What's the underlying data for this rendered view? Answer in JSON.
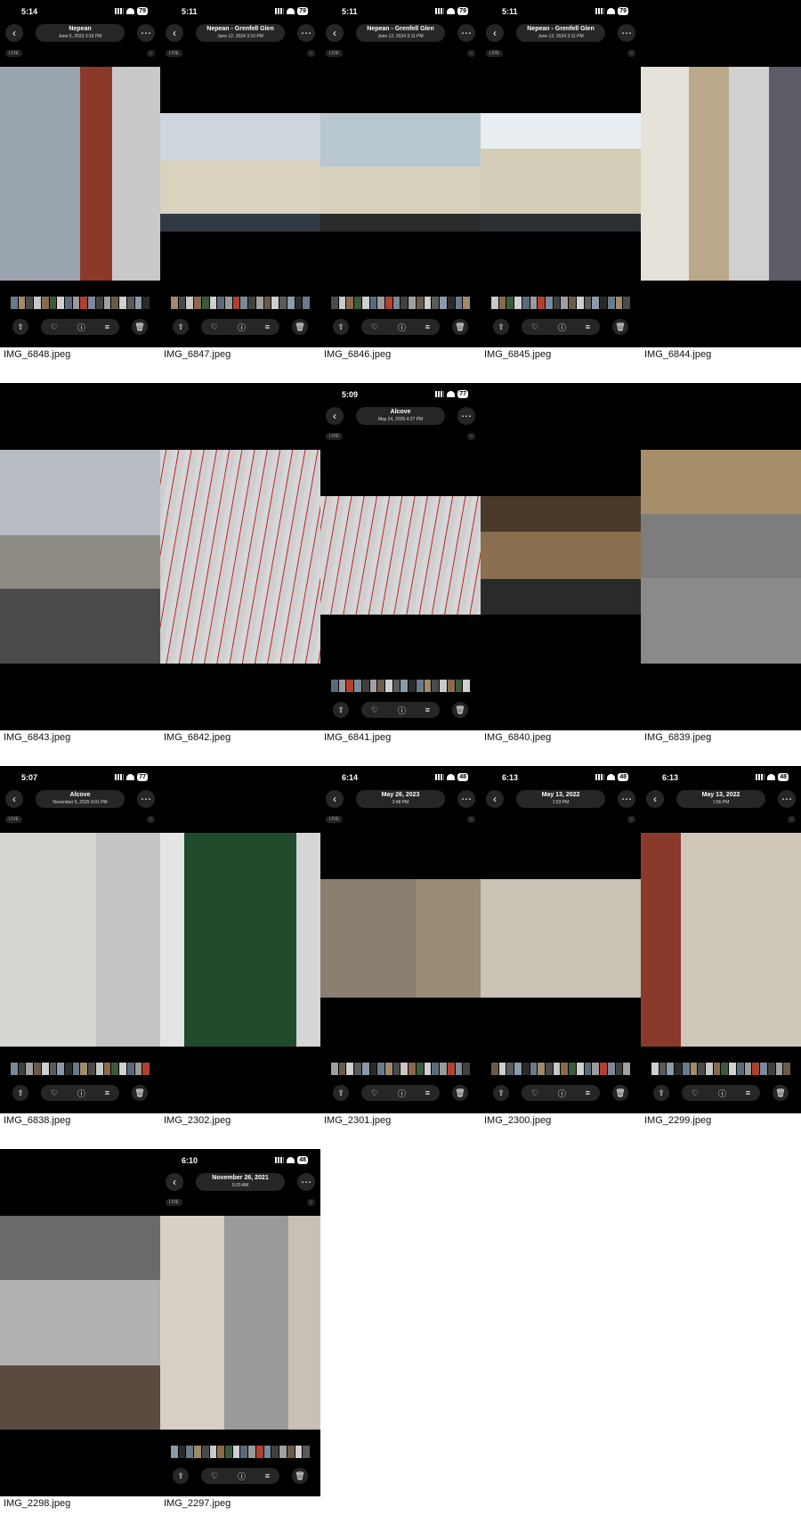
{
  "cells": [
    {
      "file": "IMG_6848.jpeg",
      "time": "5:14",
      "battery": "79",
      "title": "Nepean",
      "subtitle": "June 5, 2023  3:16 PM",
      "live": "LIVE"
    },
    {
      "file": "IMG_6847.jpeg",
      "time": "5:11",
      "battery": "79",
      "title": "Nepean - Grenfell Glen",
      "subtitle": "June 12, 2024  3:10 PM",
      "live": "LIVE"
    },
    {
      "file": "IMG_6846.jpeg",
      "time": "5:11",
      "battery": "79",
      "title": "Nepean - Grenfell Glen",
      "subtitle": "June 12, 2024  3:11 PM",
      "live": "LIVE"
    },
    {
      "file": "IMG_6845.jpeg",
      "time": "5:11",
      "battery": "79",
      "title": "Nepean - Grenfell Glen",
      "subtitle": "June 12, 2024  3:11 PM",
      "live": "LIVE"
    },
    {
      "file": "IMG_6844.jpeg"
    },
    {
      "file": "IMG_6843.jpeg"
    },
    {
      "file": "IMG_6842.jpeg"
    },
    {
      "file": "IMG_6841.jpeg",
      "time": "5:09",
      "battery": "77",
      "title": "Alcove",
      "subtitle": "May 24, 2025  4:27 PM",
      "live": "LIVE"
    },
    {
      "file": "IMG_6840.jpeg"
    },
    {
      "file": "IMG_6839.jpeg"
    },
    {
      "file": "IMG_6838.jpeg",
      "time": "5:07",
      "battery": "77",
      "title": "Alcove",
      "subtitle": "November 5, 2025  9:01 PM",
      "live": "LIVE"
    },
    {
      "file": "IMG_2302.jpeg"
    },
    {
      "file": "IMG_2301.jpeg",
      "time": "6:14",
      "battery": "48",
      "title": "May 26, 2023",
      "subtitle": "2:48 PM",
      "live": "LIVE"
    },
    {
      "file": "IMG_2300.jpeg",
      "time": "6:13",
      "battery": "48",
      "title": "May 13, 2022",
      "subtitle": "1:53 PM"
    },
    {
      "file": "IMG_2299.jpeg",
      "time": "6:13",
      "battery": "48",
      "title": "May 13, 2022",
      "subtitle": "1:56 PM"
    },
    {
      "file": "IMG_2298.jpeg"
    },
    {
      "file": "IMG_2297.jpeg",
      "time": "6:10",
      "battery": "48",
      "title": "November 26, 2021",
      "subtitle": "9:20 AM",
      "live": "LIVE"
    }
  ],
  "icons": {
    "back": "chevron-left-icon",
    "more": "ellipsis-icon",
    "share": "share-icon",
    "favorite": "heart-icon",
    "info": "info-icon",
    "adjust": "sliders-icon",
    "delete": "trash-icon"
  }
}
